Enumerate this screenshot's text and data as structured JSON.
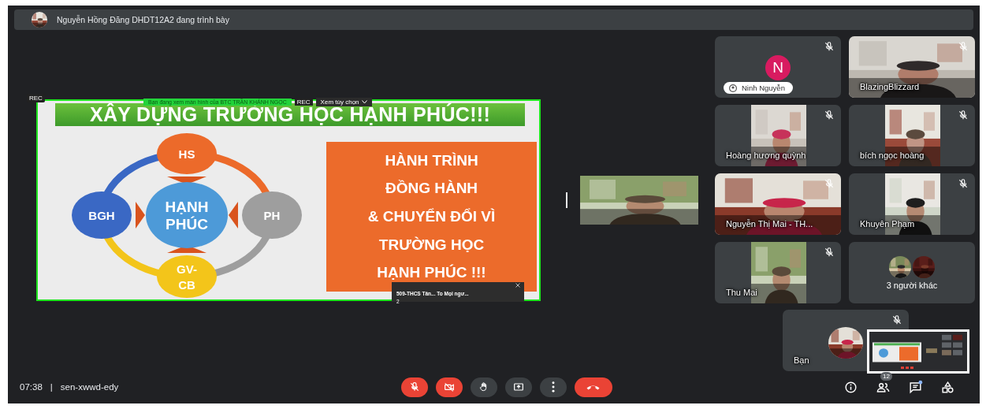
{
  "presenter_bar": {
    "text": "Nguyễn Hồng Đăng DHDT12A2 đang trình bày"
  },
  "presentation": {
    "rec": "REC",
    "banner": "Bạn đang xem màn hình của BTC TRẦN KHÁNH NGỌC",
    "banner_rec": "REC",
    "view_option": "Xem tùy chọn",
    "slide": {
      "title": "XÂY DỰNG TRƯỜNG HỌC HẠNH PHÚC!!!",
      "center": "HẠNH PHÚC",
      "nodes": [
        {
          "label": "HS",
          "color": "#ec6a2a"
        },
        {
          "label": "PH",
          "color": "#9e9e9e"
        },
        {
          "label": "GV- CB",
          "color": "#f3c51a"
        },
        {
          "label": "BGH",
          "color": "#3a68c4"
        }
      ],
      "box_lines": [
        "HÀNH TRÌNH",
        "ĐỒNG HÀNH",
        "& CHUYỂN ĐỔI VÌ",
        "TRƯỜNG HỌC",
        "HẠNH PHÚC !!!"
      ]
    },
    "popup": {
      "title": "509-THCS Tân... To Mọi ngư...",
      "count": "2"
    }
  },
  "tiles": [
    {
      "kind": "avatar",
      "name": "Ninh Nguyễn",
      "initial": "N",
      "color": "#d81b60",
      "muted": true
    },
    {
      "kind": "wide",
      "name": "BlazingBlizzard",
      "muted": true
    },
    {
      "kind": "narrow",
      "name": "Hoàng hương quỳnh",
      "muted": true
    },
    {
      "kind": "narrow",
      "name": "bích ngọc hoàng",
      "muted": true
    },
    {
      "kind": "wide",
      "name": "Nguyễn Thị Mai - TH...",
      "muted": true
    },
    {
      "kind": "narrow",
      "name": "Khuyên Phạm",
      "muted": true
    },
    {
      "kind": "narrow",
      "name": "Thu Mai",
      "muted": true
    },
    {
      "kind": "others",
      "name": "3 người khác",
      "muted": false
    }
  ],
  "self_tile": {
    "name": "Bạn",
    "muted": true
  },
  "meeting": {
    "time": "07:38",
    "separator": "|",
    "code": "sen-xwwd-edy"
  },
  "controls": [
    {
      "kind": "mic",
      "on": false
    },
    {
      "kind": "camera",
      "on": false
    },
    {
      "kind": "hand"
    },
    {
      "kind": "present"
    },
    {
      "kind": "more"
    },
    {
      "kind": "leave"
    }
  ],
  "side_icons": [
    {
      "kind": "info"
    },
    {
      "kind": "people",
      "badge": "12"
    },
    {
      "kind": "chat",
      "unread": true
    },
    {
      "kind": "activities"
    }
  ]
}
